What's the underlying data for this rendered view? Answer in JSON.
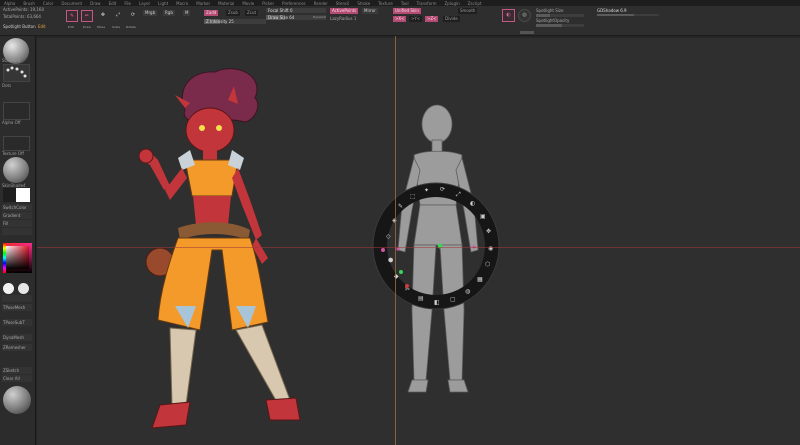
{
  "menu": [
    "Alpha",
    "Brush",
    "Color",
    "Document",
    "Draw",
    "Edit",
    "File",
    "Layer",
    "Light",
    "Macro",
    "Marker",
    "Material",
    "Movie",
    "Picker",
    "Preferences",
    "Render",
    "Stencil",
    "Stroke",
    "Texture",
    "Tool",
    "Transform",
    "Zplugin",
    "Zscript"
  ],
  "stats": {
    "active_points": "ActivePoints: 19,160",
    "total_points": "TotalPoints: 63,664"
  },
  "spotlight_button": {
    "label": "Spotlight Button",
    "state": "Edit"
  },
  "toolbar": {
    "edit_label": "Edit",
    "draw_label": "Draw",
    "move_label": "Move",
    "scale_label": "Scale",
    "rotate_label": "Rotate",
    "mrgb_label": "Mrgb",
    "rgb_label": "Rgb",
    "m_label": "M",
    "zadd_label": "Zadd",
    "zsub_label": "Zsub",
    "zcut_label": "Zcut",
    "intensity": "Z Intensity 25",
    "focal_shift": "Focal Shift 0",
    "draw_size": "Draw Size 64",
    "dynamic_label": "Dynamic",
    "active_points_btn": "ActivePoints",
    "mirror_label": "Mirror",
    "lazy_radius": "LazyRadius 1",
    "unified_label": "Unified Skin",
    "x_label": ">X<",
    "y_label": ">Y<",
    "z_label": ">Z<",
    "divide_label": "Divide",
    "smooth_label": "Smooth",
    "subdiv_label": "SDiv",
    "dist_label": "Dist",
    "imbed_label": "Imbed",
    "gizmo_label": "Gizmo",
    "spotlight_size": "Spotlight Size",
    "spotlight_opacity": "SpotlightOpacity",
    "gd_shadow": "GDShadow 6.9",
    "intensity_value": 0.25,
    "focal_value": 0.0,
    "draw_size_value": 0.32
  },
  "shelf": {
    "brush_label": "Standard",
    "stroke_label": "Dots",
    "alpha_label": "Alpha Off",
    "texture_label": "Texture Off",
    "material_label": "SkinShade4",
    "switch_color": "SwitchColor",
    "gradient_label": "Gradient",
    "fill_label": "Fill",
    "tpose_label": "TPoseMesh",
    "tpose_subt": "TPoseSubT",
    "dynamesh_label": "DynaMesh",
    "zremesher": "ZRemesher",
    "zsketch": "ZSketch",
    "clear_label": "Clear All",
    "canvas_label": "Canv 6x8"
  },
  "colors": {
    "accent": "#b54a72",
    "guide_v": "#a8743f",
    "guide_h": "#a13a3a",
    "skin": "#c2353a",
    "hair": "#7a2a4a",
    "outfit": "#f39a2a",
    "mannequin": "#9c9c9c"
  },
  "icons": [
    "edit-icon",
    "draw-icon",
    "move-icon",
    "scale-icon",
    "rotate-icon",
    "spotlight-icon",
    "spotlight-dial-icon",
    "brush-icon",
    "stroke-icon",
    "alpha-icon",
    "texture-icon",
    "material-icon",
    "color-picker-icon"
  ]
}
